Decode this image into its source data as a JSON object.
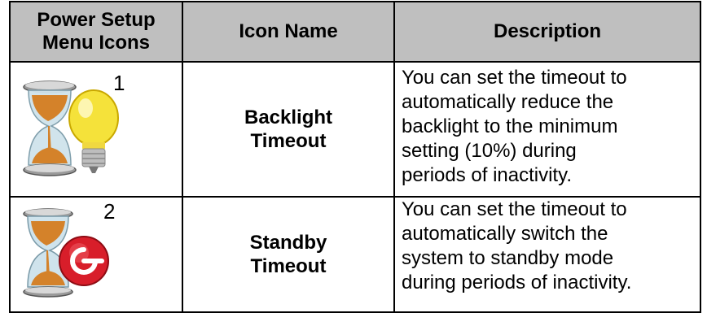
{
  "table": {
    "headers": [
      "Power Setup\nMenu Icons",
      "Icon Name",
      "Description"
    ],
    "rows": [
      {
        "icon": "hourglass-lightbulb-icon",
        "badge": "1",
        "name": "Backlight\nTimeout",
        "description": "You can set the timeout to\nautomatically reduce the\nbacklight to the minimum\nsetting (10%) during\nperiods of inactivity."
      },
      {
        "icon": "hourglass-power-icon",
        "badge": "2",
        "name": "Standby\nTimeout",
        "description": "You can set the timeout to\nautomatically switch the\nsystem to standby mode\nduring periods of inactivity."
      }
    ]
  },
  "colors": {
    "header_bg": "#bfbfbf",
    "border": "#000000",
    "sand": "#d4822a",
    "glass": "#8fb8c8",
    "bulb": "#f5e23a",
    "power_red": "#d81e2a"
  }
}
